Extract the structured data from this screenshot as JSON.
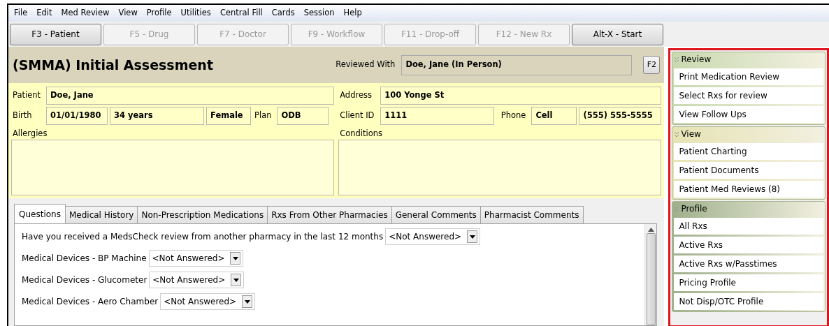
{
  "menu": [
    "File",
    "Edit",
    "Med Review",
    "View",
    "Profile",
    "Utilities",
    "Central Fill",
    "Cards",
    "Session",
    "Help"
  ],
  "toolbar": [
    {
      "label": "F3 - Patient",
      "disabled": false
    },
    {
      "label": "F5 - Drug",
      "disabled": true
    },
    {
      "label": "F7 - Doctor",
      "disabled": true
    },
    {
      "label": "F9 - Workflow",
      "disabled": true
    },
    {
      "label": "F11 - Drop-off",
      "disabled": true
    },
    {
      "label": "F12 - New Rx",
      "disabled": true
    },
    {
      "label": "Alt-X - Start",
      "disabled": false
    }
  ],
  "header": {
    "title": "(SMMA) Initial Assessment",
    "reviewed_with_label": "Reviewed With",
    "reviewed_with": "Doe, Jane (In Person)",
    "f2_button": "F2"
  },
  "patient": {
    "patient_label": "Patient",
    "patient": "Doe, Jane",
    "birth_label": "Birth",
    "birth": "01/01/1980",
    "age": "34 years",
    "sex": "Female",
    "plan_label": "Plan",
    "plan": "ODB",
    "address_label": "Address",
    "address": "100 Yonge St",
    "client_id_label": "Client ID",
    "client_id": "1111",
    "phone_label": "Phone",
    "phone_type": "Cell",
    "phone": "(555) 555-5555",
    "allergies_label": "Allergies",
    "conditions_label": "Conditions"
  },
  "tabs": [
    {
      "label": "Questions",
      "selected": true
    },
    {
      "label": "Medical History",
      "selected": false
    },
    {
      "label": "Non-Prescription Medications",
      "selected": false
    },
    {
      "label": "Rxs From Other Pharmacies",
      "selected": false
    },
    {
      "label": "General Comments",
      "selected": false
    },
    {
      "label": "Pharmacist Comments",
      "selected": false
    }
  ],
  "questions": [
    {
      "label": "Have you received a MedsCheck review from another pharmacy in the last 12 months",
      "value": "<Not Answered>"
    },
    {
      "label": "Medical Devices - BP Machine",
      "value": "<Not Answered>"
    },
    {
      "label": "Medical Devices - Glucometer",
      "value": "<Not Answered>"
    },
    {
      "label": "Medical Devices - Aero Chamber",
      "value": "<Not Answered>"
    }
  ],
  "side_panel": [
    {
      "title": "Review",
      "color": "#c9d9b0",
      "items": [
        "Print Medication Review",
        "Select Rxs for review",
        "View Follow Ups"
      ]
    },
    {
      "title": "View",
      "color": "#e6e3b4",
      "items": [
        "Patient Charting",
        "Patient Documents",
        "Patient Med Reviews (8)"
      ]
    },
    {
      "title": "Profile",
      "color": "#9fb08c",
      "items": [
        "All Rxs",
        "Active Rxs",
        "Active Rxs w/Passtimes",
        "Pricing Profile",
        "Not Disp/OTC Profile"
      ]
    }
  ]
}
